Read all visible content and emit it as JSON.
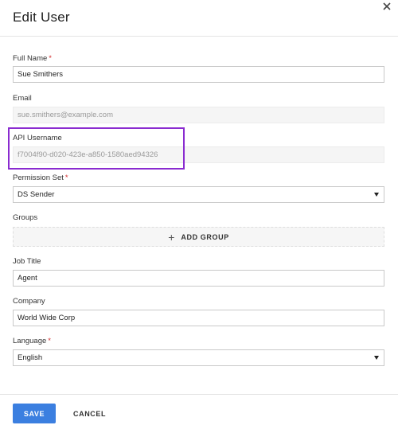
{
  "dialog": {
    "title": "Edit User",
    "close_icon": "close-icon"
  },
  "fields": {
    "full_name": {
      "label": "Full Name",
      "required": "*",
      "value": "Sue Smithers"
    },
    "email": {
      "label": "Email",
      "value": "sue.smithers@example.com"
    },
    "api_username": {
      "label": "API Username",
      "value": "f7004f90-d020-423e-a850-1580aed94326"
    },
    "permission_set": {
      "label": "Permission Set",
      "required": "*",
      "value": "DS Sender"
    },
    "groups": {
      "label": "Groups",
      "add_label": "ADD GROUP",
      "add_icon": "plus-icon"
    },
    "job_title": {
      "label": "Job Title",
      "value": "Agent"
    },
    "company": {
      "label": "Company",
      "value": "World Wide Corp"
    },
    "language": {
      "label": "Language",
      "required": "*",
      "value": "English"
    }
  },
  "footer": {
    "save_label": "SAVE",
    "cancel_label": "CANCEL"
  },
  "colors": {
    "accent": "#3b7fe0",
    "highlight": "#8a2bd0",
    "required": "#d32f2f"
  }
}
